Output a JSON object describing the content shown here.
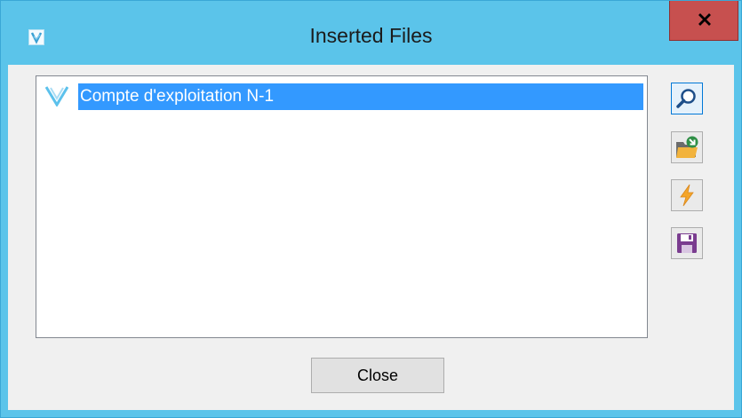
{
  "window": {
    "title": "Inserted Files",
    "app_icon": "vectorial-logo-icon",
    "close_icon": "close-icon"
  },
  "files": [
    {
      "label": "Compte d'exploitation N-1",
      "icon": "v-logo-icon",
      "selected": true
    }
  ],
  "toolbar": [
    {
      "name": "search-button",
      "icon": "magnifier-icon"
    },
    {
      "name": "import-file-button",
      "icon": "folder-arrow-icon"
    },
    {
      "name": "run-button",
      "icon": "lightning-icon"
    },
    {
      "name": "save-button",
      "icon": "floppy-disk-icon"
    }
  ],
  "footer": {
    "close_label": "Close"
  },
  "colors": {
    "titlebar": "#5bc4ea",
    "close_button_bg": "#c7504f",
    "selection": "#3399ff",
    "dialog_bg": "#f0f0f0"
  }
}
